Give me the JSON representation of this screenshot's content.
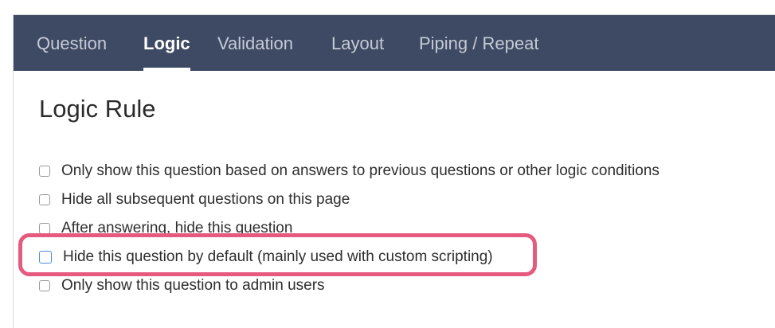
{
  "tabs": [
    {
      "label": "Question",
      "active": false
    },
    {
      "label": "Logic",
      "active": true
    },
    {
      "label": "Validation",
      "active": false
    },
    {
      "label": "Layout",
      "active": false
    },
    {
      "label": "Piping / Repeat",
      "active": false
    }
  ],
  "section_title": "Logic Rule",
  "options": [
    {
      "label": "Only show this question based on answers to previous questions or other logic conditions",
      "checked": false
    },
    {
      "label": "Hide all subsequent questions on this page",
      "checked": false
    },
    {
      "label": "After answering, hide this question",
      "checked": false
    },
    {
      "label": "Hide this question by default (mainly used with custom scripting)",
      "checked": false
    },
    {
      "label": "Only show this question to admin users",
      "checked": false
    }
  ],
  "colors": {
    "tabbar_bg": "#3e4a63",
    "highlight": "#e55a7f",
    "focus_checkbox": "#4a8ed6"
  }
}
